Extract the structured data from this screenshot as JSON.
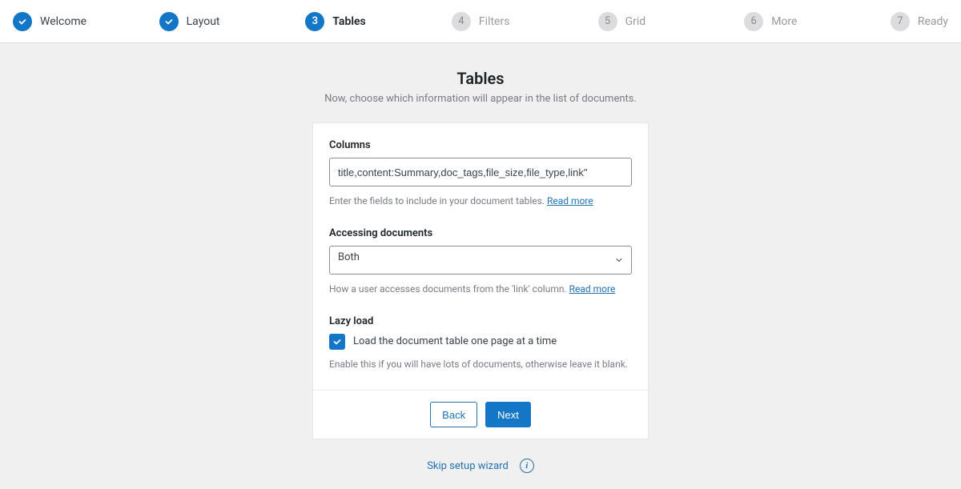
{
  "steps": [
    {
      "label": "Welcome",
      "state": "done"
    },
    {
      "label": "Layout",
      "state": "done"
    },
    {
      "num": "3",
      "label": "Tables",
      "state": "active"
    },
    {
      "num": "4",
      "label": "Filters",
      "state": "pending"
    },
    {
      "num": "5",
      "label": "Grid",
      "state": "pending"
    },
    {
      "num": "6",
      "label": "More",
      "state": "pending"
    },
    {
      "num": "7",
      "label": "Ready",
      "state": "pending"
    }
  ],
  "header": {
    "title": "Tables",
    "subtitle": "Now, choose which information will appear in the list of documents."
  },
  "columns": {
    "label": "Columns",
    "value": "title,content:Summary,doc_tags,file_size,file_type,link\"",
    "help": "Enter the fields to include in your document tables.",
    "read_more": "Read more"
  },
  "accessing": {
    "label": "Accessing documents",
    "selected": "Both",
    "help": "How a user accesses documents from the 'link' column.",
    "read_more": "Read more"
  },
  "lazy": {
    "label": "Lazy load",
    "checkbox_label": "Load the document table one page at a time",
    "checked": true,
    "help": "Enable this if you will have lots of documents, otherwise leave it blank."
  },
  "buttons": {
    "back": "Back",
    "next": "Next"
  },
  "skip": {
    "text": "Skip setup wizard"
  }
}
